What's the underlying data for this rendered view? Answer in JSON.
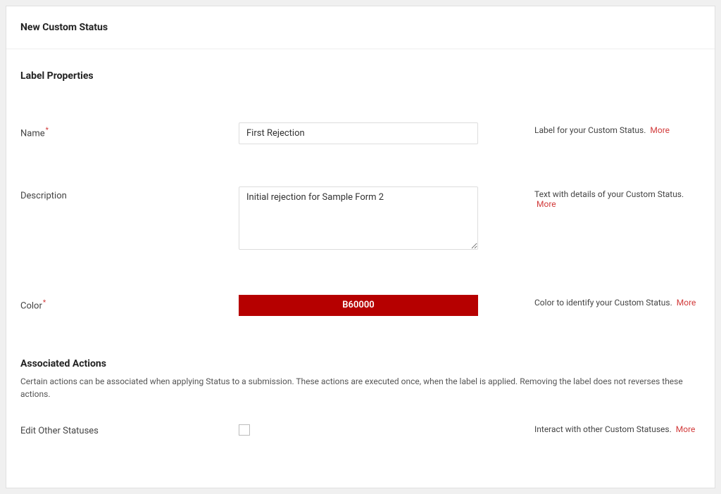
{
  "header": {
    "title": "New Custom Status"
  },
  "sections": {
    "labelProperties": {
      "title": "Label Properties"
    },
    "associatedActions": {
      "title": "Associated Actions",
      "description": "Certain actions can be associated when applying Status to a submission. These actions are executed once, when the label is applied. Removing the label does not reverses these actions."
    }
  },
  "fields": {
    "name": {
      "label": "Name",
      "value": "First Rejection",
      "help": "Label for your Custom Status.",
      "moreLink": "More"
    },
    "description": {
      "label": "Description",
      "value": "Initial rejection for Sample Form 2",
      "help": "Text with details of your Custom Status.",
      "moreLink": "More"
    },
    "color": {
      "label": "Color",
      "value": "B60000",
      "hex": "#B60000",
      "help": "Color to identify your Custom Status.",
      "moreLink": "More"
    },
    "editOtherStatuses": {
      "label": "Edit Other Statuses",
      "help": "Interact with other Custom Statuses.",
      "moreLink": "More"
    }
  },
  "requiredMark": "*"
}
